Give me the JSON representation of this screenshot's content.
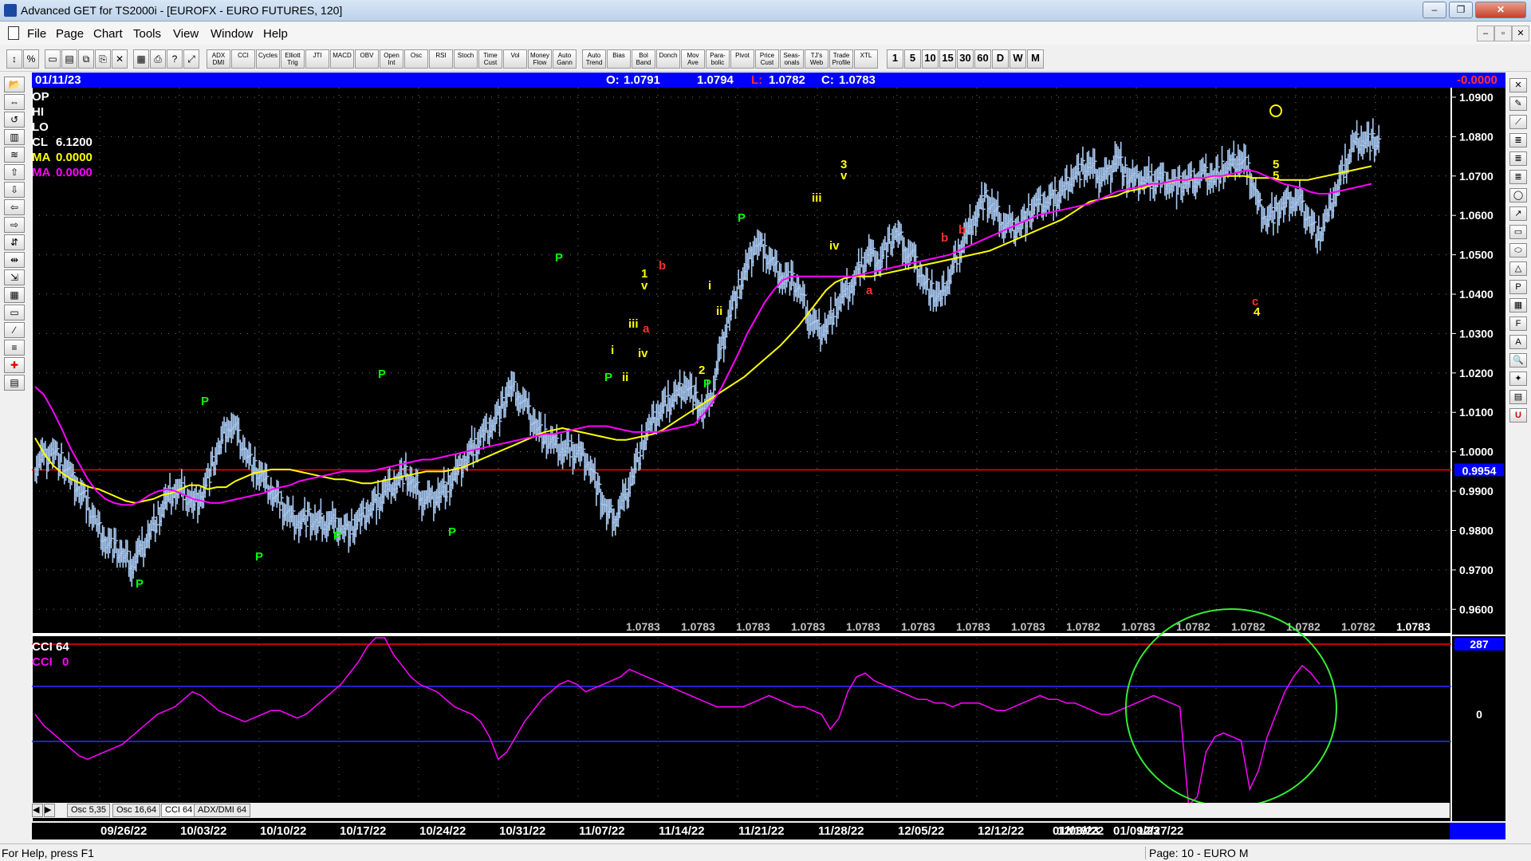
{
  "window": {
    "title": "Advanced GET for TS2000i - [EUROFX - EURO FUTURES, 120]",
    "min_label": "–",
    "max_label": "❐",
    "close_label": "✕"
  },
  "menu": [
    "File",
    "Page",
    "Chart",
    "Tools",
    "View",
    "Window",
    "Help"
  ],
  "mdi": {
    "min": "–",
    "restore": "▫",
    "close": "✕"
  },
  "toolbar": {
    "icons": [
      "arrow",
      "percent",
      "page",
      "print-setup",
      "copy",
      "paste",
      "delete",
      "grid",
      "print",
      "help",
      "pointer-help"
    ],
    "studies": [
      "ADX DMI",
      "CCI",
      "Cycles",
      "Elliott Trig",
      "JTI",
      "MACD",
      "OBV",
      "Open Int",
      "Osc",
      "RSI",
      "Stoch",
      "Time Cust",
      "Vol",
      "Money Flow",
      "Auto Gann",
      "Auto Trend",
      "Bias",
      "Bol Band",
      "Donch",
      "Mov Ave",
      "Para-bolic",
      "Pivot",
      "Price Cust",
      "Seas-onals",
      "TJ's Web",
      "Trade Profile",
      "XTL"
    ],
    "intervals": [
      "1",
      "5",
      "10",
      "15",
      "30",
      "60",
      "D",
      "W",
      "M"
    ]
  },
  "info": {
    "date": "01/11/23",
    "open_label": "O:",
    "open": "1.0791",
    "high": "1.0794",
    "low_label": "L:",
    "low": "1.0782",
    "close_label": "C:",
    "close": "1.0783",
    "change": "-0.0000"
  },
  "legend": {
    "op": "OP",
    "hi": "HI",
    "lo": "LO",
    "cl_label": "CL",
    "cl": "6.1200",
    "ma1_label": "MA",
    "ma1": "0.0000",
    "ma2_label": "MA",
    "ma2": "0.0000"
  },
  "price_axis": [
    "1.0900",
    "1.0800",
    "1.0700",
    "1.0600",
    "1.0500",
    "1.0400",
    "1.0300",
    "1.0200",
    "1.0100",
    "1.0000",
    "0.9900",
    "0.9800",
    "0.9700",
    "0.9600"
  ],
  "ref_line": {
    "value": "0.9954",
    "color": "#ff0000"
  },
  "price_strip": [
    "1.0783",
    "1.0783",
    "1.0783",
    "1.0783",
    "1.0783",
    "1.0783",
    "1.0783",
    "1.0783",
    "1.0782",
    "1.0783",
    "1.0782",
    "1.0782",
    "1.0782",
    "1.0782",
    "1.0783"
  ],
  "cci": {
    "title": "CCI 64",
    "label": "CCI",
    "value": "0",
    "axis_top": "287",
    "axis_zero": "0"
  },
  "tabs": [
    "Osc 5,35",
    "Osc 16,64",
    "CCI 64",
    "ADX/DMI 64"
  ],
  "dates": [
    "09/26/22",
    "10/03/22",
    "10/10/22",
    "10/17/22",
    "10/24/22",
    "10/31/22",
    "11/07/22",
    "11/14/22",
    "11/21/22",
    "11/28/22",
    "12/05/22",
    "12/12/22",
    "12/19/22",
    "12/27/22",
    "01/03/23",
    "01/09/23"
  ],
  "status": {
    "help": "For Help, press F1",
    "page": "Page: 10 - EURO M"
  },
  "colors": {
    "background": "#000000",
    "bars": "#a8c8f0",
    "ma_fast": "#ffff00",
    "ma_slow": "#ff00ff",
    "pivot": "#00ff00",
    "wave_yellow": "#ffff00",
    "wave_red": "#ff3030",
    "highlight_circle": "#33ee33"
  },
  "chart_data": {
    "type": "candlestick",
    "ylim": [
      0.955,
      1.091
    ],
    "price_series": [
      0.9965,
      0.9985,
      1.0005,
      0.9975,
      0.9935,
      0.9905,
      0.9865,
      0.9815,
      0.9775,
      0.9755,
      0.9735,
      0.9715,
      0.9745,
      0.9795,
      0.9835,
      0.9875,
      0.9905,
      0.9895,
      0.9865,
      0.9895,
      0.9955,
      1.0015,
      1.0075,
      1.0045,
      0.9995,
      0.9955,
      0.9925,
      0.9895,
      0.9865,
      0.9835,
      0.9825,
      0.9835,
      0.9815,
      0.9825,
      0.9815,
      0.9805,
      0.9805,
      0.9825,
      0.9855,
      0.9875,
      0.9905,
      0.9925,
      0.9945,
      0.9915,
      0.9885,
      0.9875,
      0.9895,
      0.9915,
      0.9945,
      0.9985,
      1.0015,
      1.0045,
      1.0075,
      1.0105,
      1.0165,
      1.0145,
      1.0105,
      1.0065,
      1.0035,
      1.0015,
      1.0005,
      1.0005,
      0.9995,
      0.9975,
      0.9905,
      0.9845,
      0.9835,
      0.9875,
      0.9945,
      1.0015,
      1.0065,
      1.0105,
      1.0125,
      1.0145,
      1.0175,
      1.0135,
      1.0095,
      1.0155,
      1.0255,
      1.0355,
      1.0415,
      1.0465,
      1.0535,
      1.0505,
      1.0475,
      1.0445,
      1.0435,
      1.0405,
      1.0345,
      1.0305,
      1.0315,
      1.0365,
      1.0395,
      1.0425,
      1.0475,
      1.0505,
      1.0485,
      1.0525,
      1.0555,
      1.0515,
      1.0485,
      1.0435,
      1.0405,
      1.0385,
      1.0445,
      1.0505,
      1.0555,
      1.0605,
      1.0645,
      1.0615,
      1.0585,
      1.0565,
      1.0575,
      1.0605,
      1.0625,
      1.0635,
      1.0645,
      1.0665,
      1.0705,
      1.0715,
      1.0725,
      1.0705,
      1.0695,
      1.0755,
      1.0705,
      1.0685,
      1.0695,
      1.0685,
      1.0695,
      1.0685,
      1.0675,
      1.0685,
      1.0695,
      1.0705,
      1.0695,
      1.0715,
      1.0725,
      1.0745,
      1.0715,
      1.0635,
      1.0595,
      1.0605,
      1.0625,
      1.0645,
      1.0625,
      1.0585,
      1.0545,
      1.0595,
      1.0665,
      1.0725,
      1.0785,
      1.0795,
      1.0785
    ],
    "ma_fast": [
      1.0035,
      0.9995,
      0.9965,
      0.9945,
      0.993,
      0.992,
      0.991,
      0.9905,
      0.9895,
      0.9885,
      0.9875,
      0.987,
      0.9875,
      0.988,
      0.989,
      0.9895,
      0.9905,
      0.9915,
      0.9915,
      0.9905,
      0.991,
      0.991,
      0.9925,
      0.9935,
      0.9945,
      0.995,
      0.9955,
      0.9955,
      0.9955,
      0.995,
      0.9945,
      0.994,
      0.9935,
      0.993,
      0.993,
      0.9925,
      0.992,
      0.992,
      0.9925,
      0.993,
      0.9935,
      0.994,
      0.9945,
      0.995,
      0.995,
      0.995,
      0.9955,
      0.996,
      0.997,
      0.998,
      0.999,
      1.0,
      1.001,
      1.002,
      1.003,
      1.004,
      1.005,
      1.0055,
      1.006,
      1.0055,
      1.005,
      1.0045,
      1.004,
      1.0035,
      1.003,
      1.003,
      1.0035,
      1.004,
      1.0045,
      1.0055,
      1.007,
      1.0085,
      1.01,
      1.0115,
      1.013,
      1.0145,
      1.016,
      1.0175,
      1.019,
      1.021,
      1.023,
      1.025,
      1.027,
      1.0295,
      1.032,
      1.035,
      1.038,
      1.041,
      1.043,
      1.044,
      1.0445,
      1.0445,
      1.0445,
      1.045,
      1.0455,
      1.046,
      1.0465,
      1.047,
      1.0475,
      1.048,
      1.0485,
      1.049,
      1.0495,
      1.05,
      1.0505,
      1.051,
      1.052,
      1.053,
      1.054,
      1.055,
      1.056,
      1.057,
      1.058,
      1.059,
      1.0605,
      1.062,
      1.0635,
      1.064,
      1.0645,
      1.065,
      1.066,
      1.0665,
      1.067,
      1.068,
      1.068,
      1.0685,
      1.069,
      1.069,
      1.0695,
      1.0695,
      1.07,
      1.07,
      1.07,
      1.07,
      1.0695,
      1.0695,
      1.0695,
      1.069,
      1.069,
      1.069,
      1.069,
      1.0695,
      1.07,
      1.0705,
      1.071,
      1.0715,
      1.072,
      1.0725
    ],
    "ma_slow": [
      1.0165,
      1.0145,
      1.0105,
      1.006,
      1.001,
      0.997,
      0.993,
      0.99,
      0.988,
      0.987,
      0.9865,
      0.9865,
      0.9875,
      0.989,
      0.99,
      0.9905,
      0.99,
      0.989,
      0.988,
      0.9875,
      0.987,
      0.987,
      0.9875,
      0.988,
      0.9885,
      0.989,
      0.9895,
      0.9905,
      0.991,
      0.9915,
      0.9925,
      0.993,
      0.9935,
      0.994,
      0.9945,
      0.995,
      0.995,
      0.995,
      0.995,
      0.9955,
      0.996,
      0.9965,
      0.997,
      0.9975,
      0.998,
      0.998,
      0.9985,
      0.999,
      0.9995,
      1.0,
      1.0005,
      1.001,
      1.0015,
      1.002,
      1.0025,
      1.003,
      1.0035,
      1.004,
      1.0045,
      1.0045,
      1.005,
      1.0055,
      1.006,
      1.0065,
      1.0065,
      1.0065,
      1.006,
      1.0055,
      1.005,
      1.005,
      1.005,
      1.005,
      1.0055,
      1.006,
      1.0065,
      1.007,
      1.0095,
      1.0125,
      1.016,
      1.0205,
      1.025,
      1.03,
      1.034,
      1.038,
      1.041,
      1.0435,
      1.0445,
      1.0445,
      1.0445,
      1.0445,
      1.0445,
      1.0445,
      1.0445,
      1.0445,
      1.045,
      1.0455,
      1.046,
      1.0465,
      1.047,
      1.0475,
      1.048,
      1.0485,
      1.049,
      1.0495,
      1.05,
      1.051,
      1.052,
      1.053,
      1.054,
      1.055,
      1.056,
      1.057,
      1.058,
      1.059,
      1.06,
      1.0605,
      1.061,
      1.0615,
      1.062,
      1.0625,
      1.063,
      1.064,
      1.065,
      1.066,
      1.0665,
      1.067,
      1.0675,
      1.068,
      1.068,
      1.0685,
      1.069,
      1.069,
      1.0695,
      1.0695,
      1.07,
      1.07,
      1.0705,
      1.071,
      1.0715,
      1.071,
      1.07,
      1.069,
      1.068,
      1.0675,
      1.067,
      1.066,
      1.0655,
      1.0655,
      1.066,
      1.0665,
      1.067,
      1.0675,
      1.068
    ],
    "cci_series": [
      0,
      -30,
      -50,
      -70,
      -90,
      -110,
      -120,
      -110,
      -100,
      -90,
      -80,
      -60,
      -40,
      -20,
      0,
      10,
      20,
      40,
      60,
      50,
      30,
      10,
      0,
      -10,
      -20,
      -10,
      0,
      10,
      10,
      0,
      -10,
      0,
      20,
      40,
      60,
      80,
      110,
      140,
      180,
      240,
      210,
      160,
      130,
      100,
      80,
      70,
      60,
      40,
      20,
      10,
      0,
      -20,
      -60,
      -120,
      -100,
      -60,
      -20,
      10,
      40,
      60,
      80,
      90,
      80,
      60,
      70,
      80,
      90,
      100,
      120,
      110,
      100,
      90,
      80,
      70,
      60,
      50,
      40,
      30,
      20,
      20,
      20,
      20,
      30,
      40,
      50,
      40,
      30,
      20,
      20,
      10,
      0,
      -40,
      -10,
      60,
      100,
      110,
      90,
      80,
      70,
      60,
      50,
      40,
      40,
      30,
      30,
      20,
      30,
      30,
      30,
      20,
      10,
      10,
      20,
      30,
      40,
      50,
      40,
      40,
      30,
      30,
      20,
      10,
      0,
      0,
      10,
      20,
      30,
      40,
      50,
      40,
      30,
      20,
      -250,
      -220,
      -100,
      -60,
      -50,
      -60,
      -70,
      -200,
      -150,
      -60,
      0,
      60,
      100,
      130,
      110,
      80
    ],
    "pivots_text": [
      "P",
      "P",
      "P",
      "P",
      "P",
      "P",
      "P",
      "P",
      "P",
      "P"
    ],
    "waves_yellow": [
      "1",
      "v",
      "2",
      "3",
      "v",
      "4",
      "5",
      "5",
      "i",
      "ii",
      "iii",
      "iv",
      "i",
      "ii",
      "iii",
      "iv"
    ],
    "waves_red": [
      "b",
      "a",
      "b",
      "a",
      "c",
      "b"
    ]
  }
}
